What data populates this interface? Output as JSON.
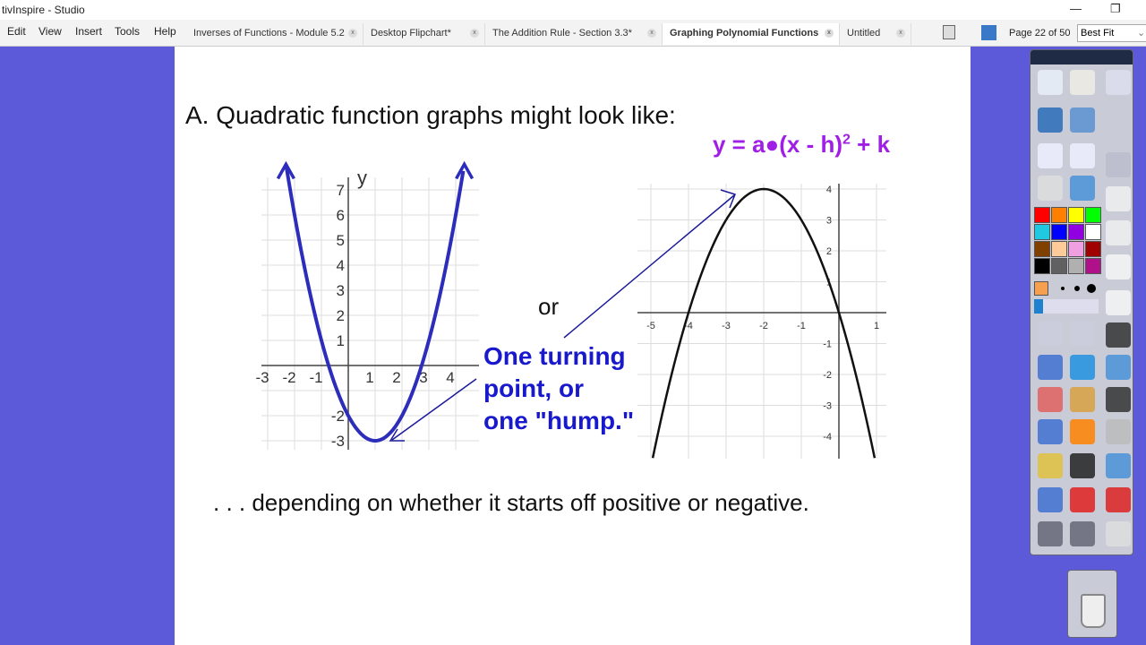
{
  "window": {
    "title": "tivInspire - Studio",
    "minimize_icon": "minimize-icon",
    "restore_icon": "restore-icon"
  },
  "menu": [
    "Edit",
    "View",
    "Insert",
    "Tools",
    "Help"
  ],
  "tabs": [
    {
      "label": "Inverses of Functions - Module 5.2",
      "active": false
    },
    {
      "label": "Desktop Flipchart*",
      "active": false
    },
    {
      "label": "The Addition Rule - Section 3.3*",
      "active": false
    },
    {
      "label": "Graphing Polynomial Functions",
      "active": true
    },
    {
      "label": "Untitled",
      "active": false
    }
  ],
  "toolbar": {
    "page_label": "Page 22 of 50",
    "zoom_value": "Best Fit"
  },
  "slide": {
    "heading": "A. Quadratic function graphs might look like:",
    "equation": "y = a●(x - h)",
    "equation_exp": "2",
    "equation_tail": " + k",
    "or": "or",
    "callout": [
      "One turning",
      "point, or",
      "one \"hump.\""
    ],
    "footer": ". . . depending on whether it starts off positive or negative.",
    "colors": {
      "equation": "#a01ee6",
      "callout": "#1818cc",
      "left_curve": "#2d2dbb",
      "right_curve": "#111111",
      "arrow": "#1a1a9a"
    }
  },
  "chart_data": [
    {
      "type": "line",
      "ylabel": "y",
      "function": {
        "a": 1,
        "h": 1,
        "k": -3
      },
      "xlim": [
        -3,
        5
      ],
      "ylim": [
        -3,
        7
      ],
      "xticks": [
        "-3",
        "-2",
        "-1",
        "1",
        "2",
        "3",
        "4"
      ],
      "yticks": [
        "7",
        "6",
        "5",
        "4",
        "3",
        "2",
        "1",
        "-2",
        "-3"
      ],
      "x": [
        -2,
        -1,
        0,
        1,
        2,
        3,
        4
      ],
      "y": [
        6,
        1,
        -2,
        -3,
        -2,
        1,
        6
      ],
      "grid": true,
      "arrows_on_ends": true
    },
    {
      "type": "line",
      "function": {
        "a": -1,
        "h": -2,
        "k": 4
      },
      "xlim": [
        -5,
        1
      ],
      "ylim": [
        -4,
        4
      ],
      "xticks": [
        "-5",
        "-4",
        "-3",
        "-2",
        "-1",
        "1"
      ],
      "yticks": [
        "4",
        "3",
        "2",
        "1",
        "-1",
        "-2",
        "-3",
        "-4"
      ],
      "x": [
        -4,
        -3,
        -2,
        -1,
        0
      ],
      "y": [
        0,
        3,
        4,
        3,
        0
      ],
      "grid": true
    }
  ],
  "toolbox": {
    "colors": [
      "#ff0000",
      "#ff8000",
      "#ffff00",
      "#00ff00",
      "#20c8e0",
      "#0000ff",
      "#9000e0",
      "#ffffff",
      "#804000",
      "#ffcc99",
      "#f0a0e0",
      "#a00000",
      "#000000",
      "#606060",
      "#b0b0b0",
      "#b0108a"
    ]
  }
}
